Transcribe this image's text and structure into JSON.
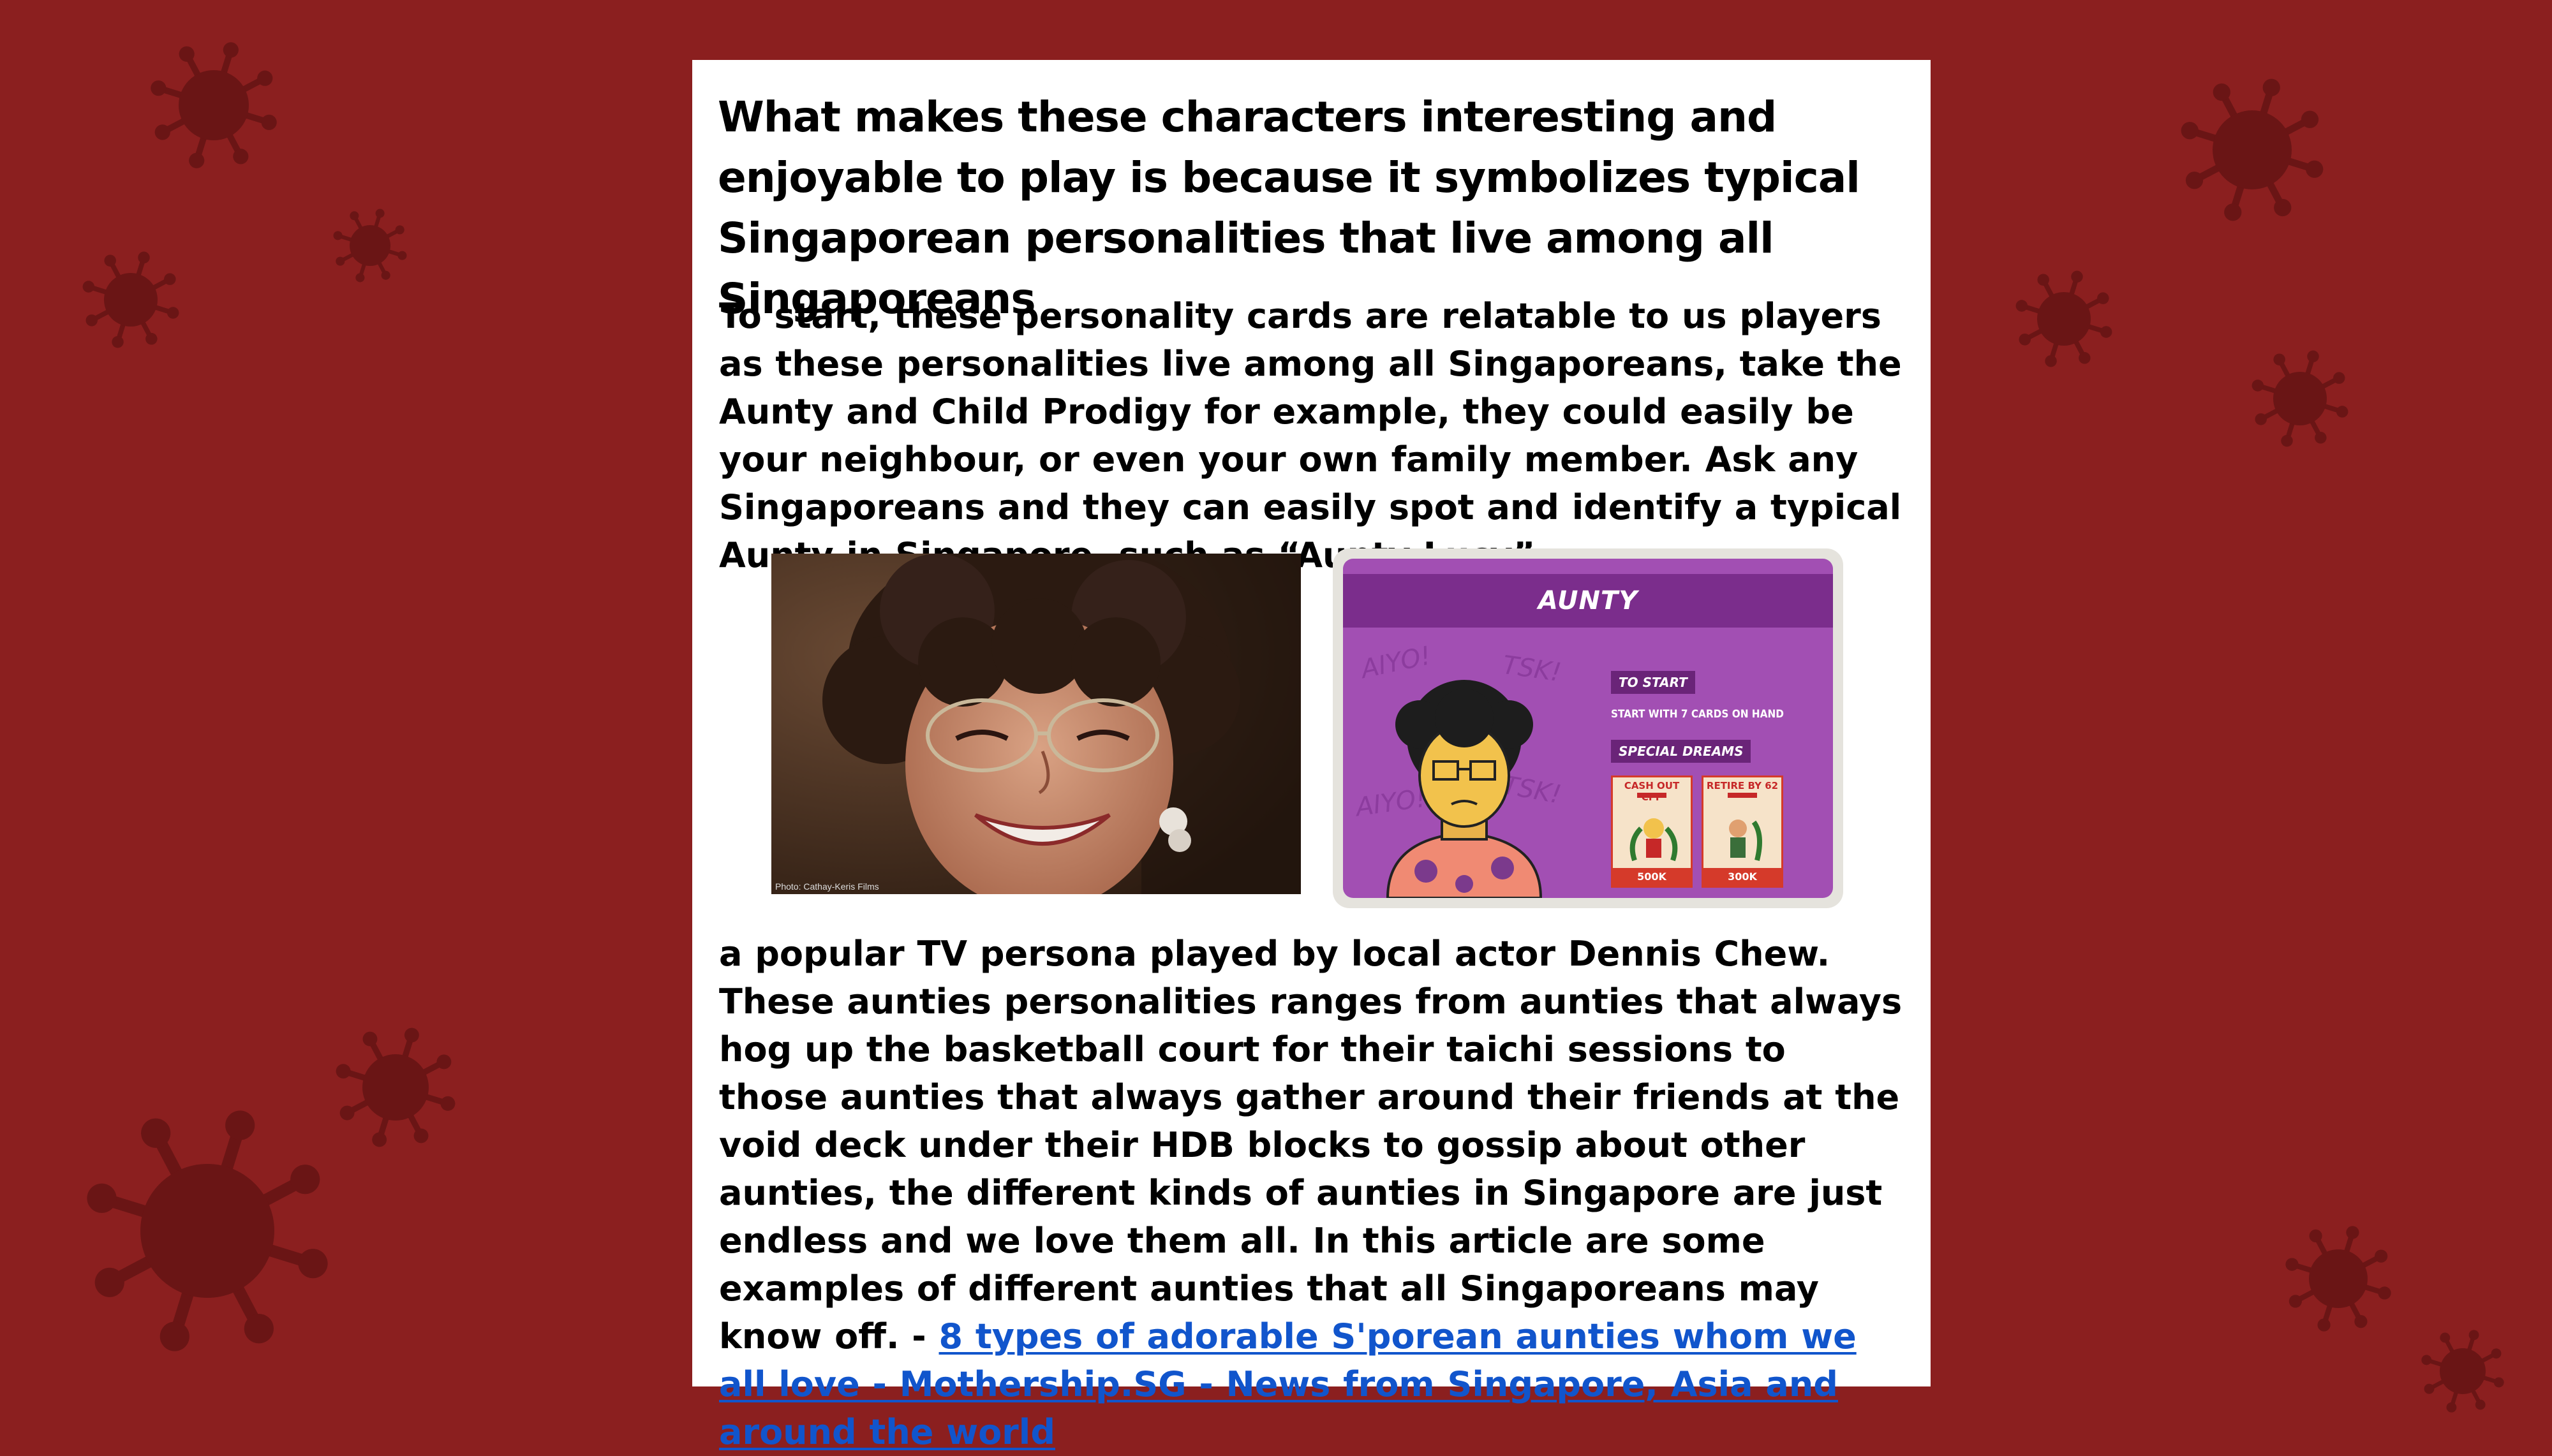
{
  "slide": {
    "background_color": "#8b1f1f",
    "virus_icon_color": "#6a1515",
    "heading": "What makes these characters interesting and enjoyable to play is because it symbolizes typical Singaporean personalities that live among all Singaporeans",
    "paragraph1": "To start, these personality cards are relatable to us players as these personalities live among all Singaporeans, take the Aunty and Child Prodigy for example, they could easily be your neighbour, or even your own family member. Ask any Singaporeans and they can easily spot and identify a typical Aunty in Singapore, such as “Aunty Lucy”,",
    "paragraph2": "a popular TV persona played by local actor Dennis Chew. These aunties personalities ranges from aunties that always hog up the basketball court for their taichi sessions to those aunties that always gather around their friends at the void deck under their HDB blocks to gossip about other aunties, the different kinds of aunties in Singapore are just endless and we love them all. In this article are some examples of different aunties that all Singaporeans may know off. - ",
    "link_text": "8 types of adorable S'porean aunties whom we all love - Mothership.SG - News from Singapore, Asia and around the world",
    "link_color": "#1155cc"
  },
  "photo": {
    "credit": "Photo: Cathay-Keris Films"
  },
  "game_card": {
    "title": "AUNTY",
    "to_start_label": "TO START",
    "to_start_text": "START WITH 7 CARDS ON HAND",
    "special_label": "SPECIAL DREAMS",
    "scribbles": [
      "AIYO!",
      "TSK!",
      "AIYO!",
      "TSK!"
    ],
    "dreams": [
      {
        "title": "CASH OUT CPF",
        "value": "500K"
      },
      {
        "title": "RETIRE BY 62",
        "value": "300K"
      }
    ],
    "card_color": "#a24fb3",
    "title_bar_color": "#7b2d8c"
  }
}
